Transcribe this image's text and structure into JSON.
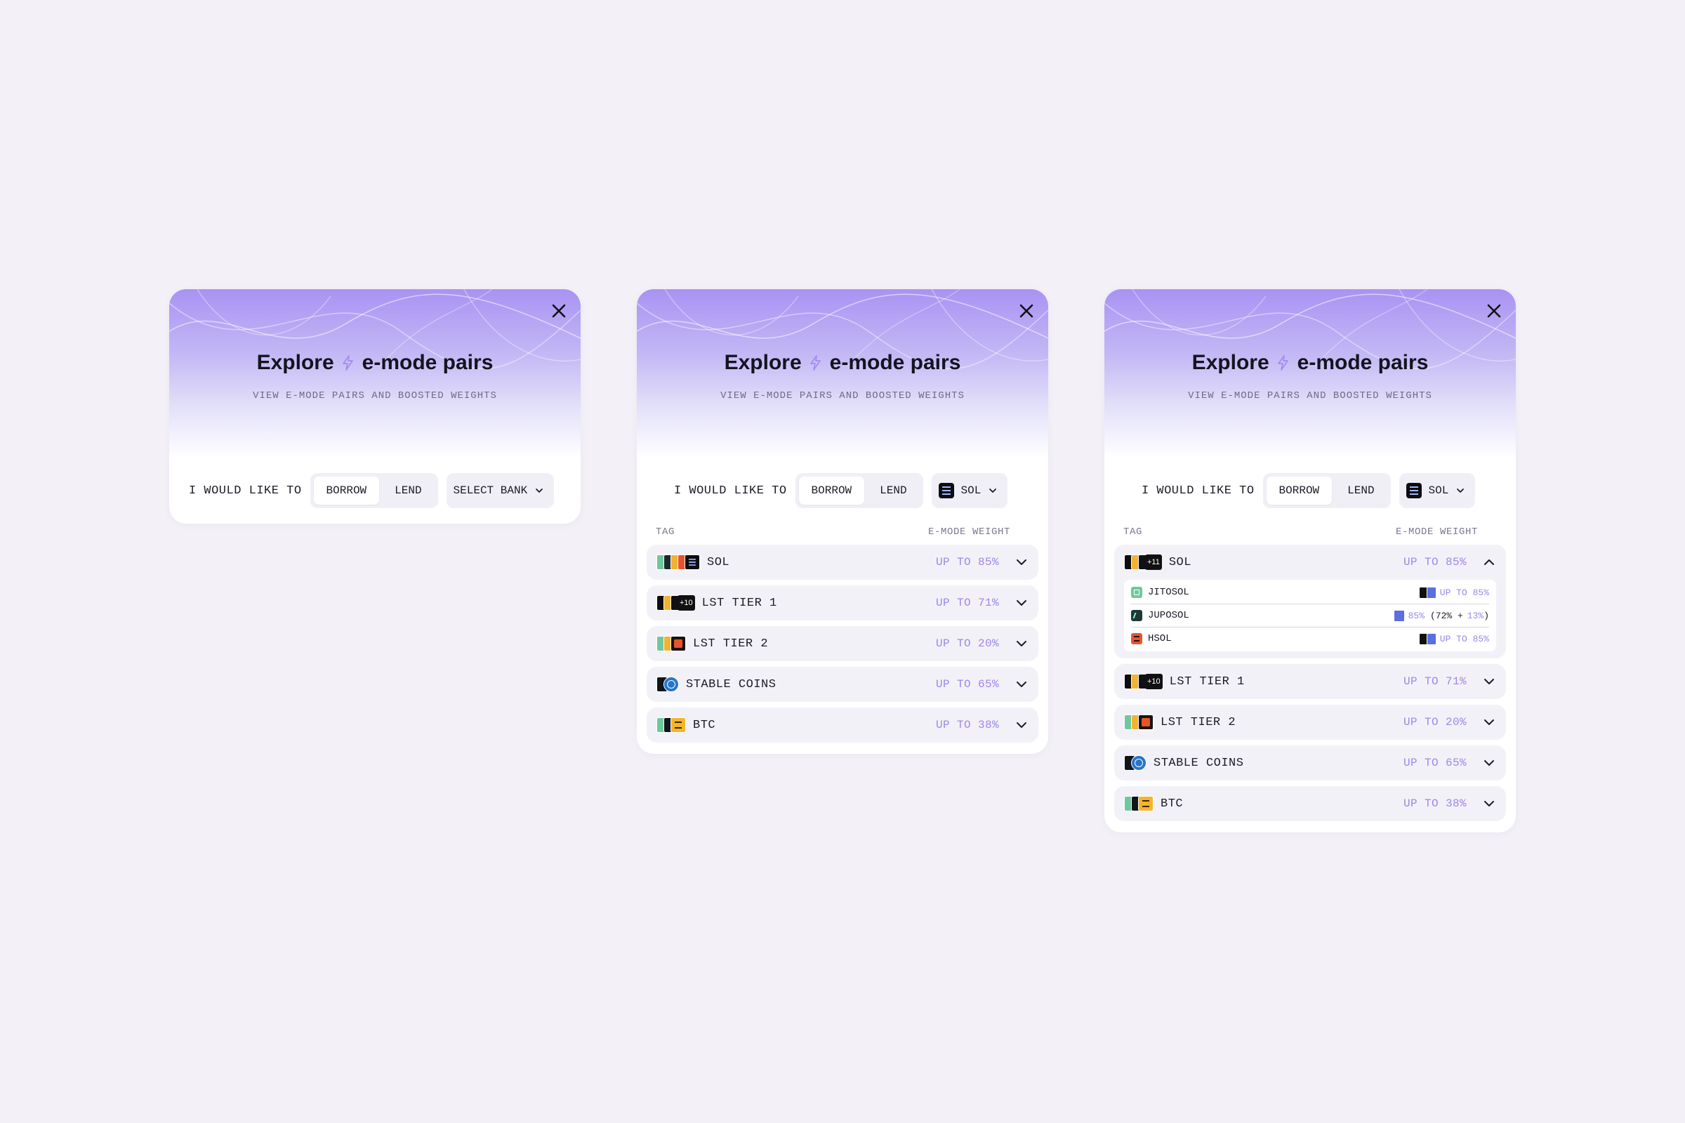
{
  "title_left": "Explore",
  "title_right": "e-mode pairs",
  "subtitle": "VIEW E-MODE PAIRS AND BOOSTED WEIGHTS",
  "controls": {
    "label": "I WOULD LIKE TO",
    "borrow": "BORROW",
    "lend": "LEND",
    "select_bank_placeholder": "SELECT BANK",
    "selected_bank": "SOL"
  },
  "table": {
    "tag_header": "TAG",
    "weight_header": "E-MODE WEIGHT"
  },
  "colors": {
    "accent": "#9d86ec",
    "row_bg": "#f3f1f8",
    "background": "#f3f1f7"
  },
  "panels": [
    {
      "state": "empty"
    },
    {
      "state": "collapsed",
      "rows": [
        {
          "name": "SOL",
          "weight": "UP TO 85%",
          "icons": [
            "jitosol",
            "juposol",
            "bsol",
            "hsol",
            "sol"
          ]
        },
        {
          "name": "LST TIER 1",
          "weight": "UP TO 71%",
          "icons": [
            "lst-a",
            "lst-b",
            "lst-c"
          ],
          "extra": "+10"
        },
        {
          "name": "LST TIER 2",
          "weight": "UP TO 20%",
          "icons": [
            "lst-d",
            "lst-e",
            "hsol"
          ]
        },
        {
          "name": "STABLE COINS",
          "weight": "UP TO 65%",
          "icons": [
            "stable-a",
            "usdc"
          ]
        },
        {
          "name": "BTC",
          "weight": "UP TO 38%",
          "icons": [
            "btc-a",
            "btc-b",
            "btc-c"
          ]
        }
      ]
    },
    {
      "state": "expanded",
      "rows": [
        {
          "name": "SOL",
          "weight": "UP TO 85%",
          "extra": "+11"
        },
        {
          "name": "LST TIER 1",
          "weight": "UP TO 71%",
          "extra": "+10"
        },
        {
          "name": "LST TIER 2",
          "weight": "UP TO 20%"
        },
        {
          "name": "STABLE COINS",
          "weight": "UP TO 65%"
        },
        {
          "name": "BTC",
          "weight": "UP TO 38%"
        }
      ],
      "sub_rows": [
        {
          "name": "JITOSOL",
          "weight": "UP TO 85%"
        },
        {
          "name": "JUPOSOL",
          "weight_a": "85%",
          "weight_b": "(72% + ",
          "weight_c": "13%",
          "weight_d": ")"
        },
        {
          "name": "HSOL",
          "weight": "UP TO 85%"
        }
      ]
    }
  ]
}
